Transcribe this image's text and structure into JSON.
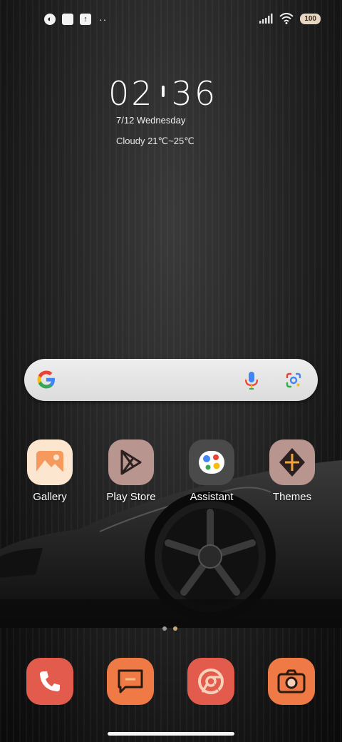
{
  "status_bar": {
    "battery": "100",
    "notification_dots": "··"
  },
  "lockclock": {
    "hour": "02",
    "minute": "36",
    "date": "7/12 Wednesday",
    "weather": "Cloudy 21℃~25℃"
  },
  "search_bar": {
    "icons": [
      "google-icon",
      "microphone-icon",
      "google-lens-icon"
    ]
  },
  "apps": [
    {
      "label": "Gallery",
      "icon": "gallery-icon",
      "color": "#fde6cf"
    },
    {
      "label": "Play Store",
      "icon": "play-store-icon",
      "color": "#b8958f"
    },
    {
      "label": "Assistant",
      "icon": "assistant-icon",
      "color": "#4a4a4a"
    },
    {
      "label": "Themes",
      "icon": "themes-icon",
      "color": "#b8958f"
    }
  ],
  "dock": [
    {
      "name": "phone",
      "icon": "phone-icon",
      "color": "#e35b4c"
    },
    {
      "name": "messages",
      "icon": "message-icon",
      "color": "#ef7a45"
    },
    {
      "name": "browser",
      "icon": "chrome-icon",
      "color": "#e35b4c"
    },
    {
      "name": "camera",
      "icon": "camera-icon",
      "color": "#ef7a45"
    }
  ],
  "page_indicator": {
    "pages": 2,
    "current": 2
  }
}
